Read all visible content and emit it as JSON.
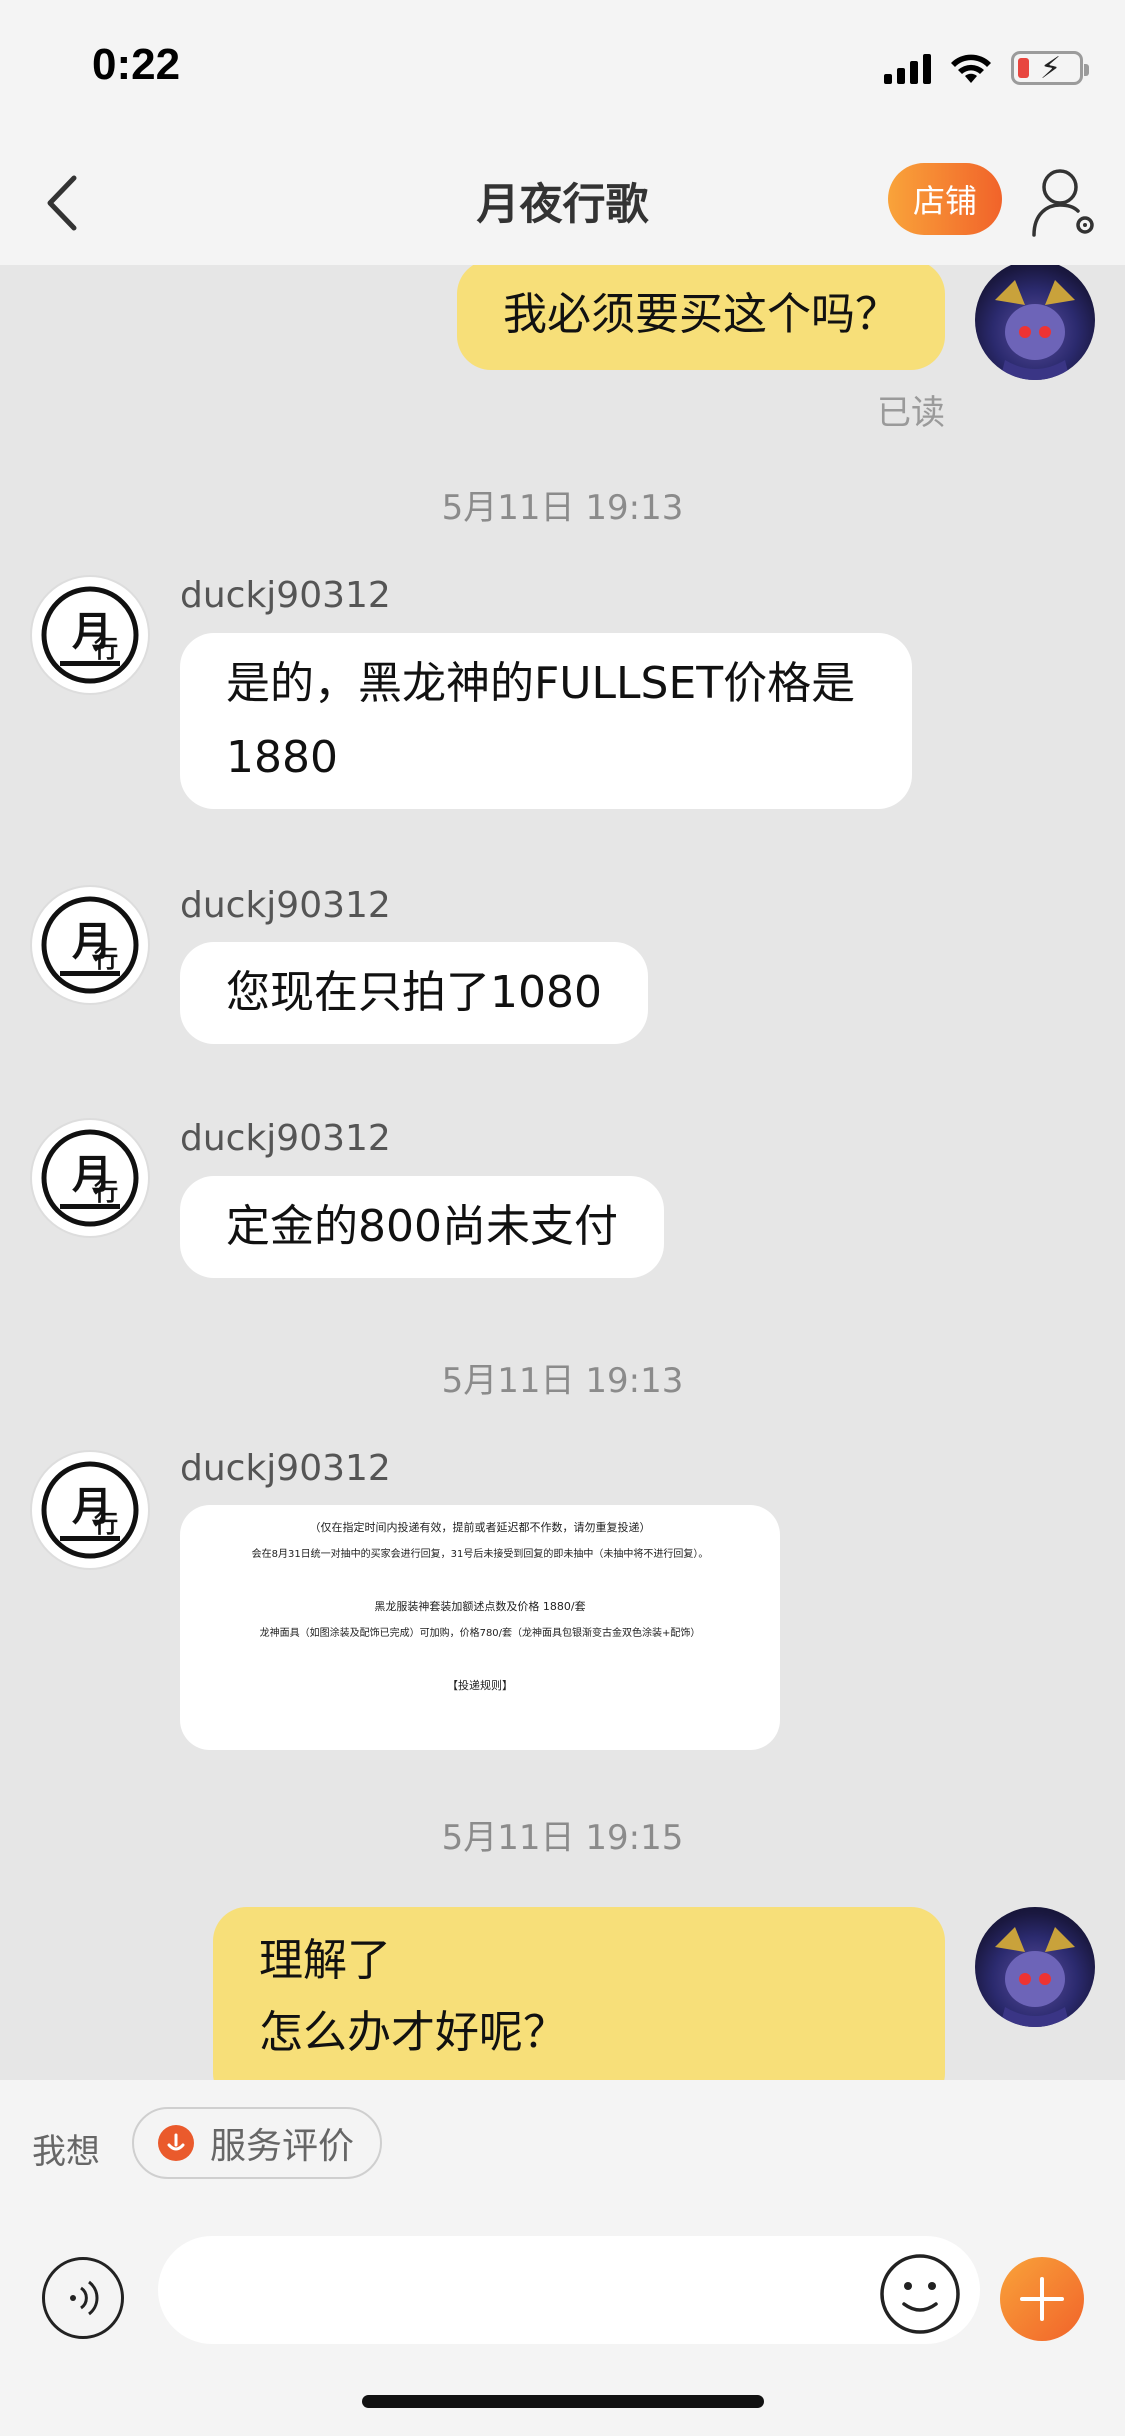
{
  "status_bar": {
    "time": "0:22"
  },
  "header": {
    "title": "月夜行歌",
    "shop_label": "店铺"
  },
  "chat": {
    "msg_out_1": "我必须要买这个吗？",
    "read_receipt": "已读",
    "timestamp_1": "5月11日 19:13",
    "sender_1": "duckj90312",
    "msg_in_1": "是的，黑龙神的FULLSET价格是1880",
    "sender_2": "duckj90312",
    "msg_in_2": "您现在只拍了1080",
    "sender_3": "duckj90312",
    "msg_in_3": "定金的800尚未支付",
    "timestamp_2": "5月11日 19:13",
    "sender_4": "duckj90312",
    "image_msg": {
      "line1": "（仅在指定时间内投递有效，提前或者延迟都不作数，请勿重复投递）",
      "line2": "会在8月31日统一对抽中的买家会进行回复，31号后未接受到回复的即未抽中（未抽中将不进行回复）。",
      "line3": "黑龙服装神套装加额述点数及价格 1880/套",
      "line4": "龙神面具（如图涂装及配饰已完成）可加购，价格780/套（龙神面具包银渐变古金双色涂装+配饰）",
      "line5": "【投递规则】"
    },
    "timestamp_3": "5月11日 19:15",
    "msg_out_2_line1": "理解了",
    "msg_out_2_line2": "怎么办才好呢？",
    "shop_avatar_text": "月行"
  },
  "quick_bar": {
    "label": "我想",
    "chip": "服务评价"
  },
  "input": {
    "placeholder": ""
  },
  "colors": {
    "accent": "#f1632a",
    "bubble_out": "#f7df79",
    "bubble_in": "#ffffff",
    "chat_bg": "#e6e6e6"
  }
}
